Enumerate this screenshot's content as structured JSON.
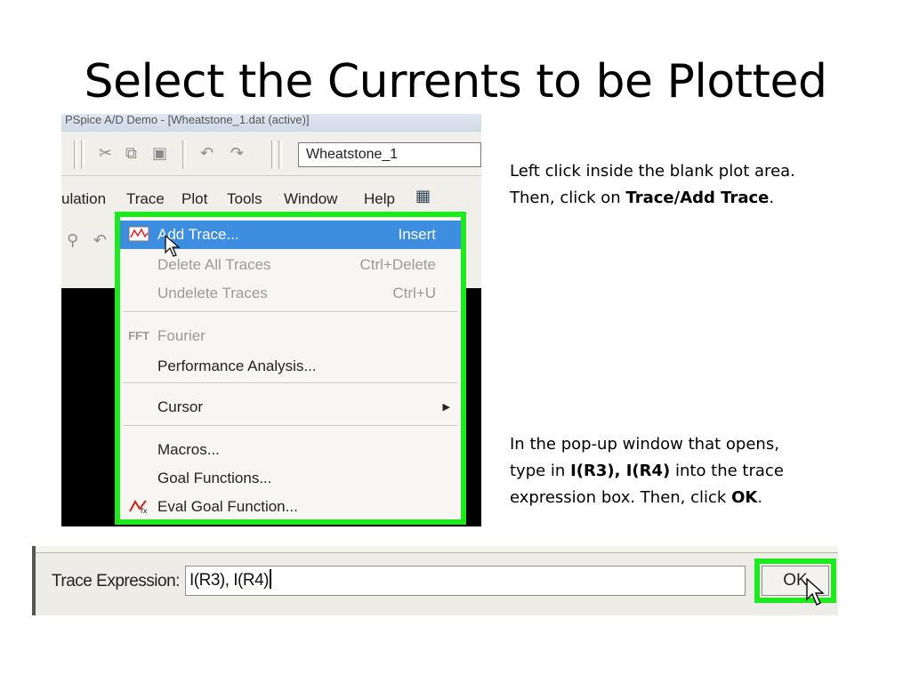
{
  "slide": {
    "title": "Select the Currents to be Plotted"
  },
  "pspice": {
    "window_title": "PSpice A/D Demo - [Wheatstone_1.dat (active)]",
    "profile_combo": "Wheatstone_1",
    "menubar": {
      "simulation_partial": "ulation",
      "trace": "Trace",
      "plot": "Plot",
      "tools": "Tools",
      "window": "Window",
      "help": "Help"
    },
    "trace_menu": {
      "items": [
        {
          "label": "Add Trace...",
          "shortcut": "Insert",
          "state": "highlighted",
          "icon": "add-trace-icon"
        },
        {
          "label": "Delete All Traces",
          "shortcut": "Ctrl+Delete",
          "state": "disabled"
        },
        {
          "label": "Undelete Traces",
          "shortcut": "Ctrl+U",
          "state": "disabled"
        },
        {
          "label": "Fourier",
          "shortcut": "",
          "state": "disabled",
          "icon": "fourier-icon"
        },
        {
          "label": "Performance Analysis...",
          "shortcut": "",
          "state": "normal"
        },
        {
          "label": "Cursor",
          "shortcut": "",
          "state": "normal",
          "submenu": true
        },
        {
          "label": "Macros...",
          "shortcut": "",
          "state": "normal"
        },
        {
          "label": "Goal Functions...",
          "shortcut": "",
          "state": "normal"
        },
        {
          "label": "Eval Goal Function...",
          "shortcut": "",
          "state": "normal",
          "icon": "eval-goal-icon"
        }
      ],
      "highlight_color": "#1ee81e"
    }
  },
  "instructions": {
    "step1_line1": "Left click inside the blank plot area.",
    "step1_line2_prefix": "Then, click on ",
    "step1_bold": "Trace/Add Trace",
    "step1_suffix": ".",
    "step2_line1": "In the pop-up window that opens,",
    "step2_line2_prefix": "type in ",
    "step2_bold_expr": "I(R3), I(R4)",
    "step2_line2_suffix": " into the trace",
    "step2_line3_prefix": "expression box.  Then, click ",
    "step2_bold_ok": "OK",
    "step2_suffix": "."
  },
  "trace_expression_dialog": {
    "label": "Trace Expression:",
    "value": "I(R3), I(R4)",
    "ok_button": "OK"
  }
}
